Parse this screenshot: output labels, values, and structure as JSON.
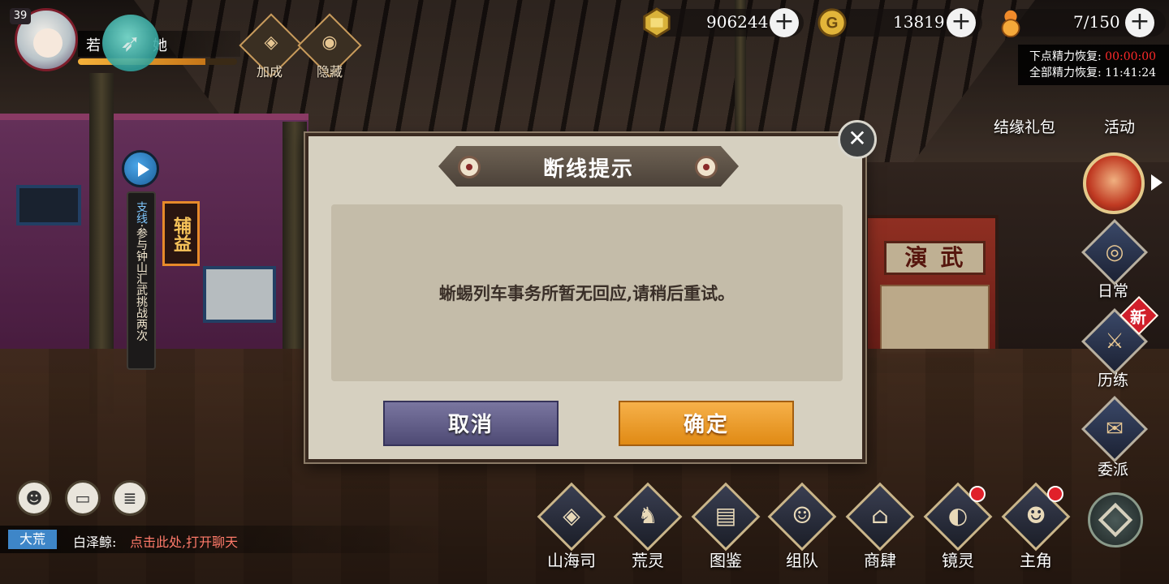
{
  "player": {
    "level": "39",
    "name": "若",
    "name_suffix": "她",
    "exp_progress": 0.8
  },
  "buffs": [
    {
      "label": "加成",
      "icon": "bonus-icon"
    },
    {
      "label": "隐藏",
      "icon": "eye-icon"
    }
  ],
  "currency": {
    "gold": "906244",
    "coins": "13819",
    "stamina": "7/150"
  },
  "stamina_recovery": {
    "next_label": "下点精力恢复:",
    "next_time": "00:00:00",
    "full_label": "全部精力恢复:",
    "full_time": "11:41:24"
  },
  "quest": {
    "prefix": "支线",
    "text": "参与钟山汇武挑战两次",
    "sign": "辅益"
  },
  "scene": {
    "stage_sign": "演武"
  },
  "right_menu": [
    {
      "label": "结缘礼包",
      "icon": "gift-icon"
    },
    {
      "label": "活动",
      "icon": "event-icon"
    },
    {
      "label": "日常",
      "icon": "daily-icon"
    },
    {
      "label": "历练",
      "icon": "training-icon"
    },
    {
      "label": "委派",
      "icon": "dispatch-icon"
    }
  ],
  "new_badge": "新",
  "bottom_menu": [
    {
      "label": "山海司",
      "icon": "shanhaisi-icon",
      "dot": false
    },
    {
      "label": "荒灵",
      "icon": "huangling-icon",
      "dot": false
    },
    {
      "label": "图鉴",
      "icon": "cards-icon",
      "dot": false
    },
    {
      "label": "组队",
      "icon": "team-icon",
      "dot": false
    },
    {
      "label": "商肆",
      "icon": "shop-icon",
      "dot": false
    },
    {
      "label": "镜灵",
      "icon": "mirror-icon",
      "dot": true
    },
    {
      "label": "主角",
      "icon": "hero-icon",
      "dot": true
    }
  ],
  "chat": {
    "channel": "大荒",
    "speaker": "白泽鲸:",
    "message": "点击此处,打开聊天"
  },
  "dialog": {
    "title": "断线提示",
    "message": "蜥蜴列车事务所暂无回应,请稍后重试。",
    "cancel_label": "取消",
    "confirm_label": "确定",
    "close_symbol": "✕"
  }
}
